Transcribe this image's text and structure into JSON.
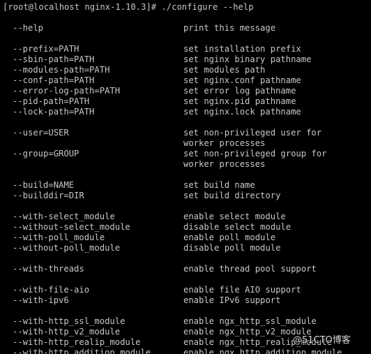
{
  "terminal": {
    "prompt": "[root@localhost nginx-1.10.3]# ./configure --help",
    "lines": [
      {
        "opt": "--help",
        "desc": "print this message"
      },
      {
        "opt": "--prefix=PATH",
        "desc": "set installation prefix"
      },
      {
        "opt": "--sbin-path=PATH",
        "desc": "set nginx binary pathname"
      },
      {
        "opt": "--modules-path=PATH",
        "desc": "set modules path"
      },
      {
        "opt": "--conf-path=PATH",
        "desc": "set nginx.conf pathname"
      },
      {
        "opt": "--error-log-path=PATH",
        "desc": "set error log pathname"
      },
      {
        "opt": "--pid-path=PATH",
        "desc": "set nginx.pid pathname"
      },
      {
        "opt": "--lock-path=PATH",
        "desc": "set nginx.lock pathname"
      },
      {
        "opt": "--user=USER",
        "desc": "set non-privileged user for"
      },
      {
        "opt": "",
        "desc": "worker processes"
      },
      {
        "opt": "--group=GROUP",
        "desc": "set non-privileged group for"
      },
      {
        "opt": "",
        "desc": "worker processes"
      },
      {
        "opt": "--build=NAME",
        "desc": "set build name"
      },
      {
        "opt": "--builddir=DIR",
        "desc": "set build directory"
      },
      {
        "opt": "--with-select_module",
        "desc": "enable select module"
      },
      {
        "opt": "--without-select_module",
        "desc": "disable select module"
      },
      {
        "opt": "--with-poll_module",
        "desc": "enable poll module"
      },
      {
        "opt": "--without-poll_module",
        "desc": "disable poll module"
      },
      {
        "opt": "--with-threads",
        "desc": "enable thread pool support"
      },
      {
        "opt": "--with-file-aio",
        "desc": "enable file AIO support"
      },
      {
        "opt": "--with-ipv6",
        "desc": "enable IPv6 support"
      },
      {
        "opt": "--with-http_ssl_module",
        "desc": "enable ngx_http_ssl_module"
      },
      {
        "opt": "--with-http_v2_module",
        "desc": "enable ngx_http_v2_module"
      },
      {
        "opt": "--with-http_realip_module",
        "desc": "enable ngx_http_realip_module"
      },
      {
        "opt": "--with-http_addition_module",
        "desc": "enable ngx_http_addition_module"
      }
    ]
  },
  "watermark": "@51CTO博客"
}
